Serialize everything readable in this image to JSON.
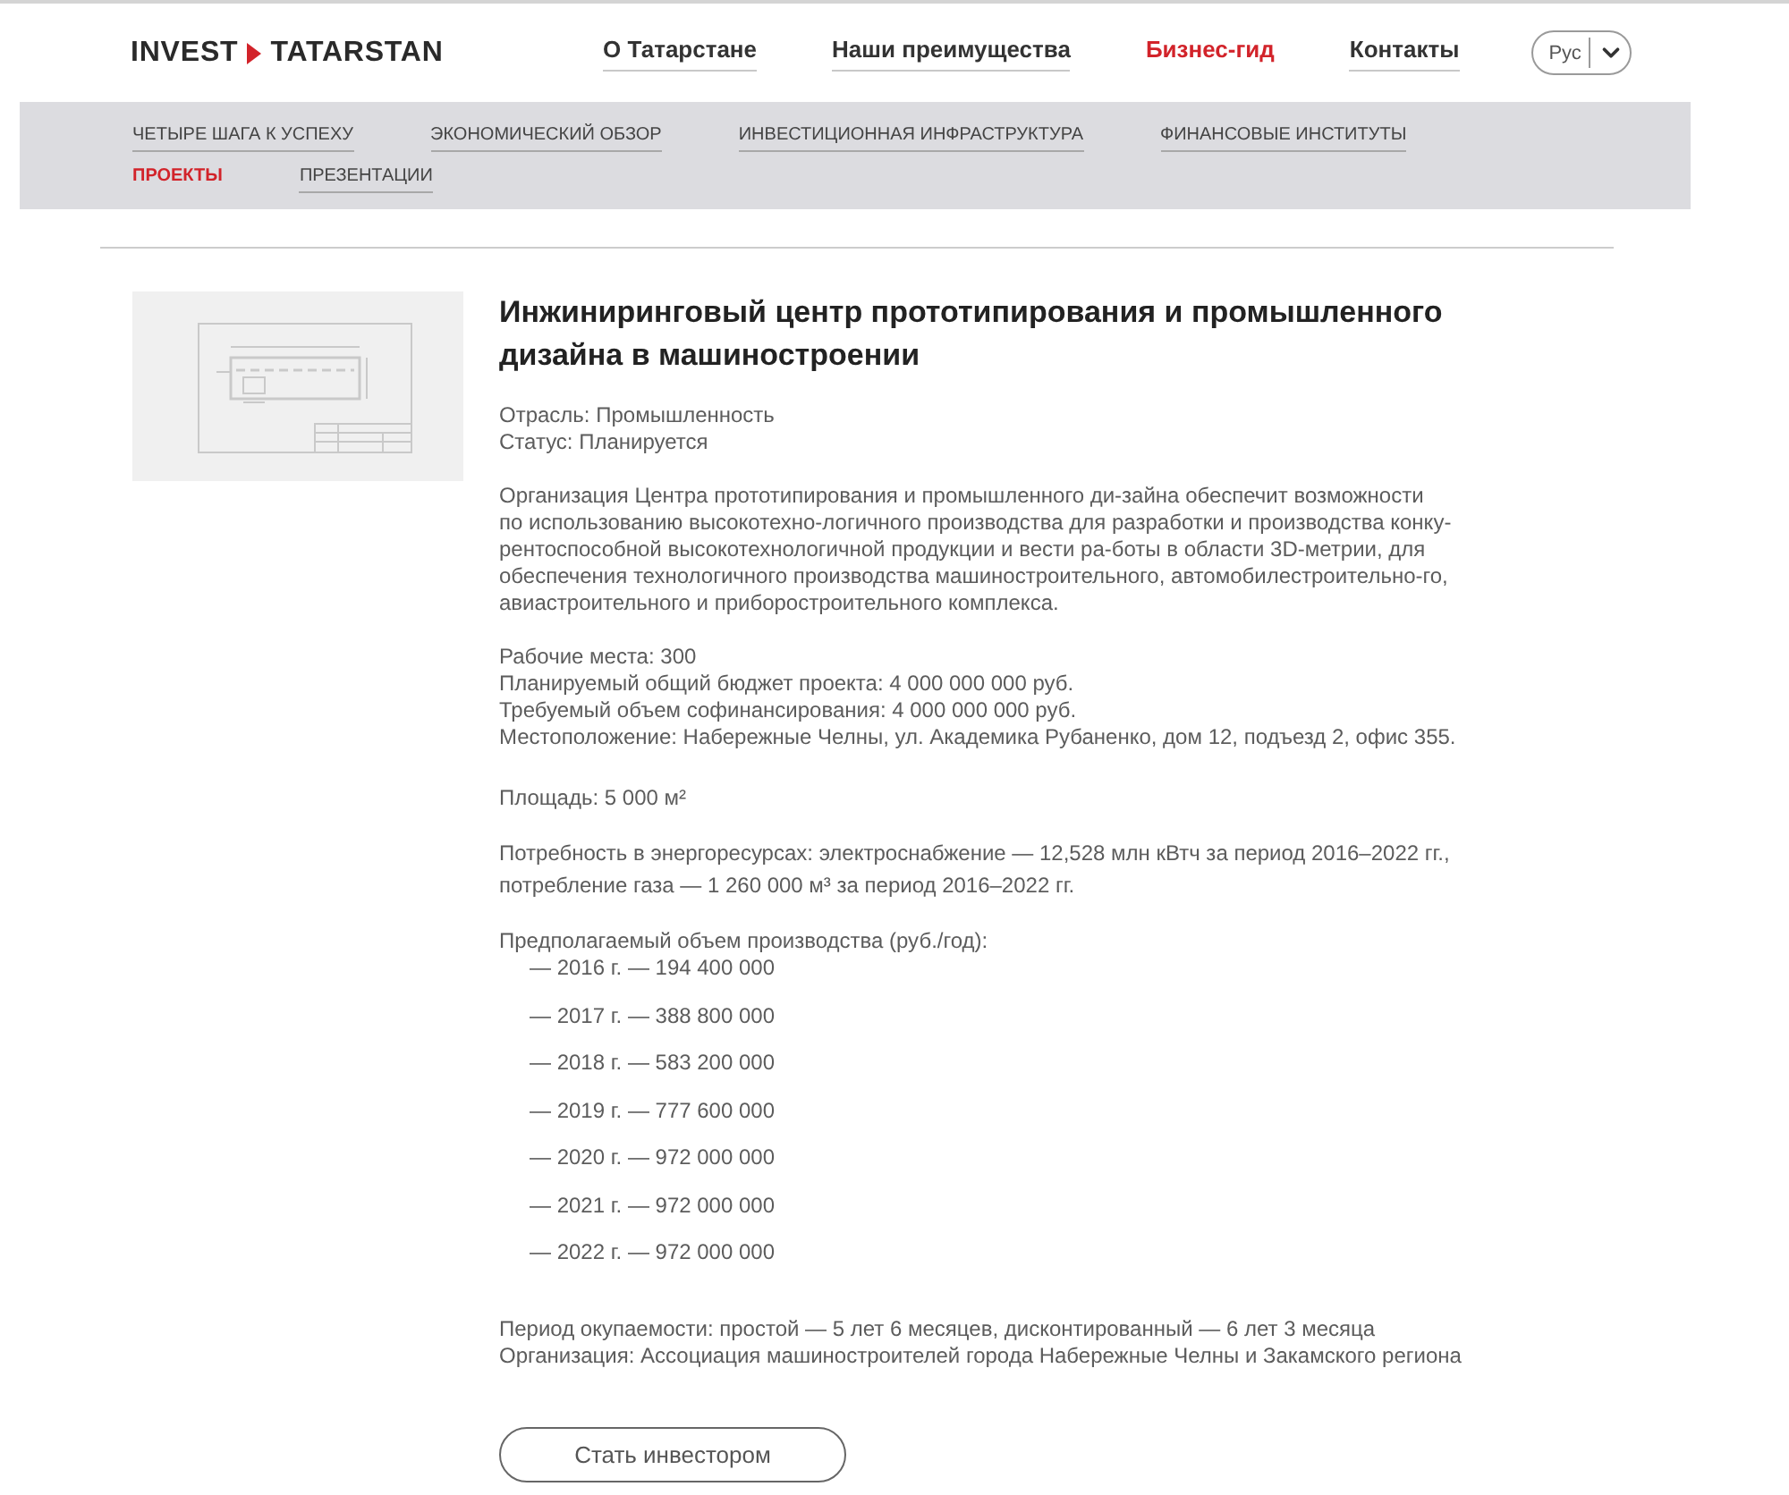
{
  "logo": {
    "left": "INVEST",
    "right": "TATARSTAN"
  },
  "nav": [
    {
      "label": "О Татарстане",
      "selected": false
    },
    {
      "label": "Наши преимущества",
      "selected": false
    },
    {
      "label": "Бизнес-гид",
      "selected": true
    },
    {
      "label": "Контакты",
      "selected": false
    }
  ],
  "language": {
    "value": "Рус"
  },
  "subnav_rows": [
    [
      {
        "label": "ЧЕТЫРЕ ШАГА К УСПЕХУ",
        "selected": false
      },
      {
        "label": "ЭКОНОМИЧЕСКИЙ ОБЗОР",
        "selected": false
      },
      {
        "label": "ИНВЕСТИЦИОННАЯ ИНФРАСТРУКТУРА",
        "selected": false
      },
      {
        "label": "ФИНАНСОВЫЕ ИНСТИТУТЫ",
        "selected": false
      }
    ],
    [
      {
        "label": "ПРОЕКТЫ",
        "selected": true
      },
      {
        "label": "ПРЕЗЕНТАЦИИ",
        "selected": false
      }
    ]
  ],
  "project": {
    "title": "Инжиниринговый центр прототипирования и промышленного дизайна в машиностроении",
    "meta_lines": [
      "Отрасль: Промышленность",
      "Статус: Планируется"
    ],
    "description_lines": [
      "Организация Центра прототипирования и промышленного ди-зайна обеспечит возможности",
      "по использованию высокотехно-логичного производства для разработки и производства конку-",
      "рентоспособной высокотехнологичной продукции и вести ра-боты в области 3D-метрии, для",
      "обеспечения технологичного производства машиностроительного, автомобилестроительно-го,",
      "авиастроительного и приборостроительного комплекса."
    ],
    "facts": [
      "Рабочие места: 300",
      "Планируемый общий бюджет проекта: 4 000 000 000 руб.",
      "Требуемый объем софинансирования: 4 000 000 000 руб.",
      "Местоположение: Набережные Челны, ул. Академика Рубаненко, дом 12, подъезд 2, офис 355."
    ],
    "area": "Площадь: 5 000 м²",
    "energy_lines": [
      "Потребность в энергоресурсах: электроснабжение — 12,528 млн кВтч за период 2016–2022 гг.,",
      "потребление газа — 1 260 000 м³ за период 2016–2022 гг."
    ],
    "production": {
      "heading": "Предполагаемый объем производства (руб./год):",
      "items": [
        "— 2016 г. — 194 400 000",
        "— 2017 г. — 388 800 000",
        "— 2018 г. — 583 200 000",
        "— 2019 г. — 777 600 000",
        "— 2020 г. — 972 000 000",
        "— 2021 г. — 972 000 000",
        "— 2022 г. — 972 000 000"
      ]
    },
    "payback_lines": [
      "Период окупаемости: простой — 5 лет 6 месяцев, дисконтированный — 6 лет 3 месяца",
      "Организация: Ассоциация машиностроителей города Набережные Челны и Закамского региона"
    ],
    "invest_button": "Стать инвестором"
  }
}
